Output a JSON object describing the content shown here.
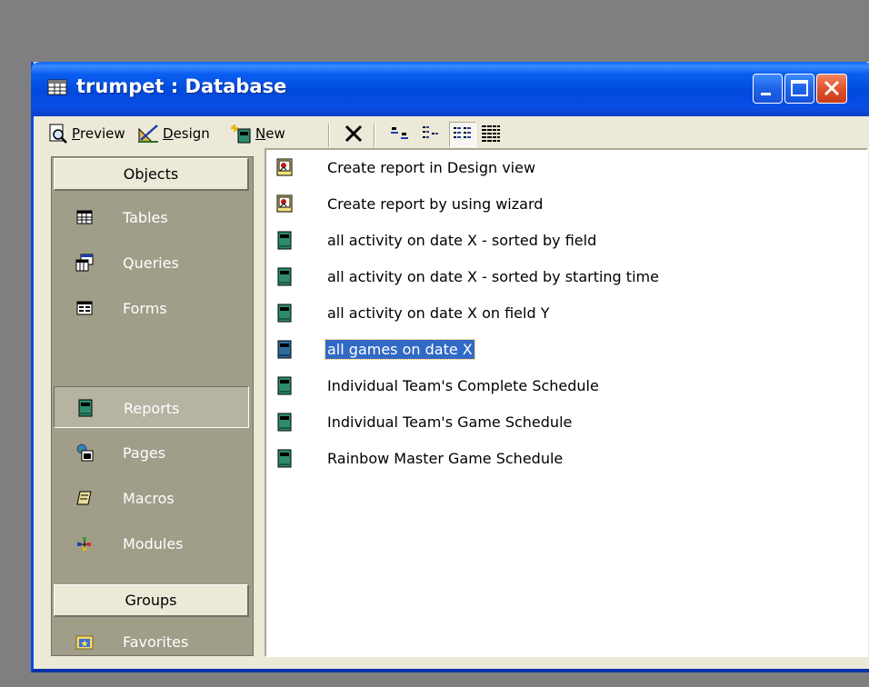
{
  "window": {
    "title": "trumpet : Database",
    "colors": {
      "titlebar": "#0054e3",
      "close_button": "#e0532b",
      "panel_bg": "#a09d89",
      "selection": "#316ac5"
    }
  },
  "toolbar": {
    "preview_accel": "P",
    "preview_rest": "review",
    "design_accel": "D",
    "design_rest": "esign",
    "new_accel": "N",
    "new_rest": "ew",
    "icons": [
      "preview-icon",
      "design-icon",
      "new-icon",
      "delete-icon",
      "large-icons-view-icon",
      "small-icons-view-icon",
      "list-view-icon",
      "details-view-icon"
    ]
  },
  "objects": {
    "header": "Objects",
    "items": [
      {
        "label": "Tables",
        "icon": "table-icon"
      },
      {
        "label": "Queries",
        "icon": "query-icon"
      },
      {
        "label": "Forms",
        "icon": "form-icon"
      },
      {
        "label": "Reports",
        "icon": "report-icon",
        "selected": true
      },
      {
        "label": "Pages",
        "icon": "page-icon"
      },
      {
        "label": "Macros",
        "icon": "macro-icon"
      },
      {
        "label": "Modules",
        "icon": "module-icon"
      }
    ]
  },
  "groups": {
    "header": "Groups",
    "items": [
      {
        "label": "Favorites",
        "icon": "favorites-folder-icon"
      }
    ]
  },
  "reports_list": {
    "items": [
      {
        "label": "Create report in Design view",
        "icon": "shortcut-icon"
      },
      {
        "label": "Create report by using wizard",
        "icon": "shortcut-icon"
      },
      {
        "label": "all activity on date X - sorted by field",
        "icon": "report-icon"
      },
      {
        "label": "all activity on date X - sorted by starting time",
        "icon": "report-icon"
      },
      {
        "label": "all activity on date X on field Y",
        "icon": "report-icon"
      },
      {
        "label": "all games on date X",
        "icon": "report-icon",
        "selected": true
      },
      {
        "label": "Individual Team's Complete Schedule",
        "icon": "report-icon"
      },
      {
        "label": "Individual Team's Game Schedule",
        "icon": "report-icon"
      },
      {
        "label": "Rainbow Master Game Schedule",
        "icon": "report-icon"
      }
    ]
  }
}
